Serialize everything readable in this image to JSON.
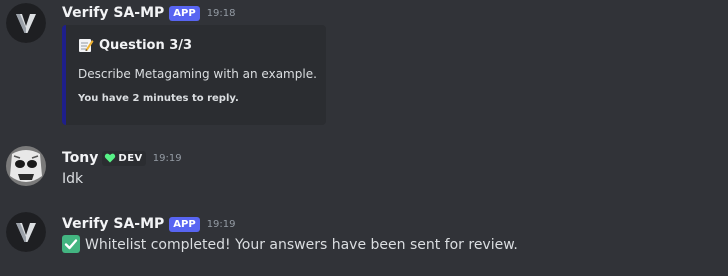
{
  "messages": [
    {
      "author": "Verify SA-MP",
      "tag": "APP",
      "time": "19:18",
      "embed": {
        "title": "Question 3/3",
        "description": "Describe Metagaming with an example.",
        "footer": "You have 2 minutes to reply."
      }
    },
    {
      "author": "Tony",
      "role_tag": "DEV",
      "time": "19:19",
      "text": "Idk"
    },
    {
      "author": "Verify SA-MP",
      "tag": "APP",
      "time": "19:19",
      "text": "Whitelist completed! Your answers have been sent for review."
    }
  ],
  "colors": {
    "background": "#313338",
    "app_tag": "#5865f2",
    "embed_border": "#1e1f8a",
    "check": "#43b581",
    "heart": "#57f287"
  },
  "icons": {
    "bot_avatar": "v-logo-icon",
    "user_avatar": "mask-avatar-icon",
    "embed_title_icon": "memo-icon",
    "role_icon": "heart-icon",
    "completed_icon": "check-mark-icon"
  }
}
